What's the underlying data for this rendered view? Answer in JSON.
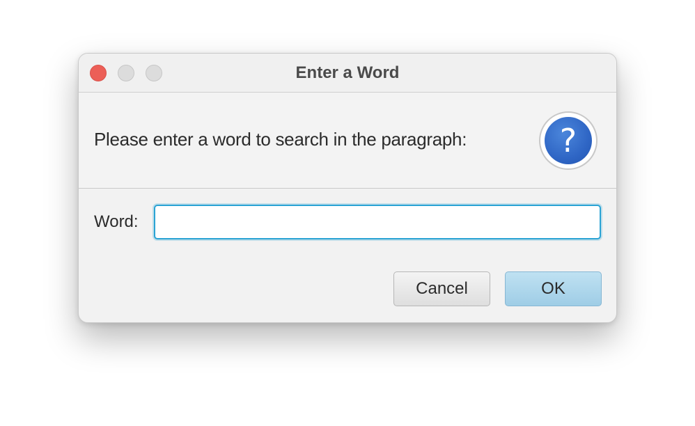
{
  "window": {
    "title": "Enter a Word"
  },
  "dialog": {
    "header_message": "Please enter a word to search in the paragraph:",
    "icon": "question-icon",
    "icon_glyph": "?",
    "field_label": "Word:",
    "field_value": "",
    "field_placeholder": ""
  },
  "buttons": {
    "cancel_label": "Cancel",
    "ok_label": "OK"
  },
  "colors": {
    "close": "#ec5f57",
    "accent_focus": "#2aa3d4",
    "ok_button": "#a9d3ea",
    "icon_blue": "#2f66c5"
  }
}
